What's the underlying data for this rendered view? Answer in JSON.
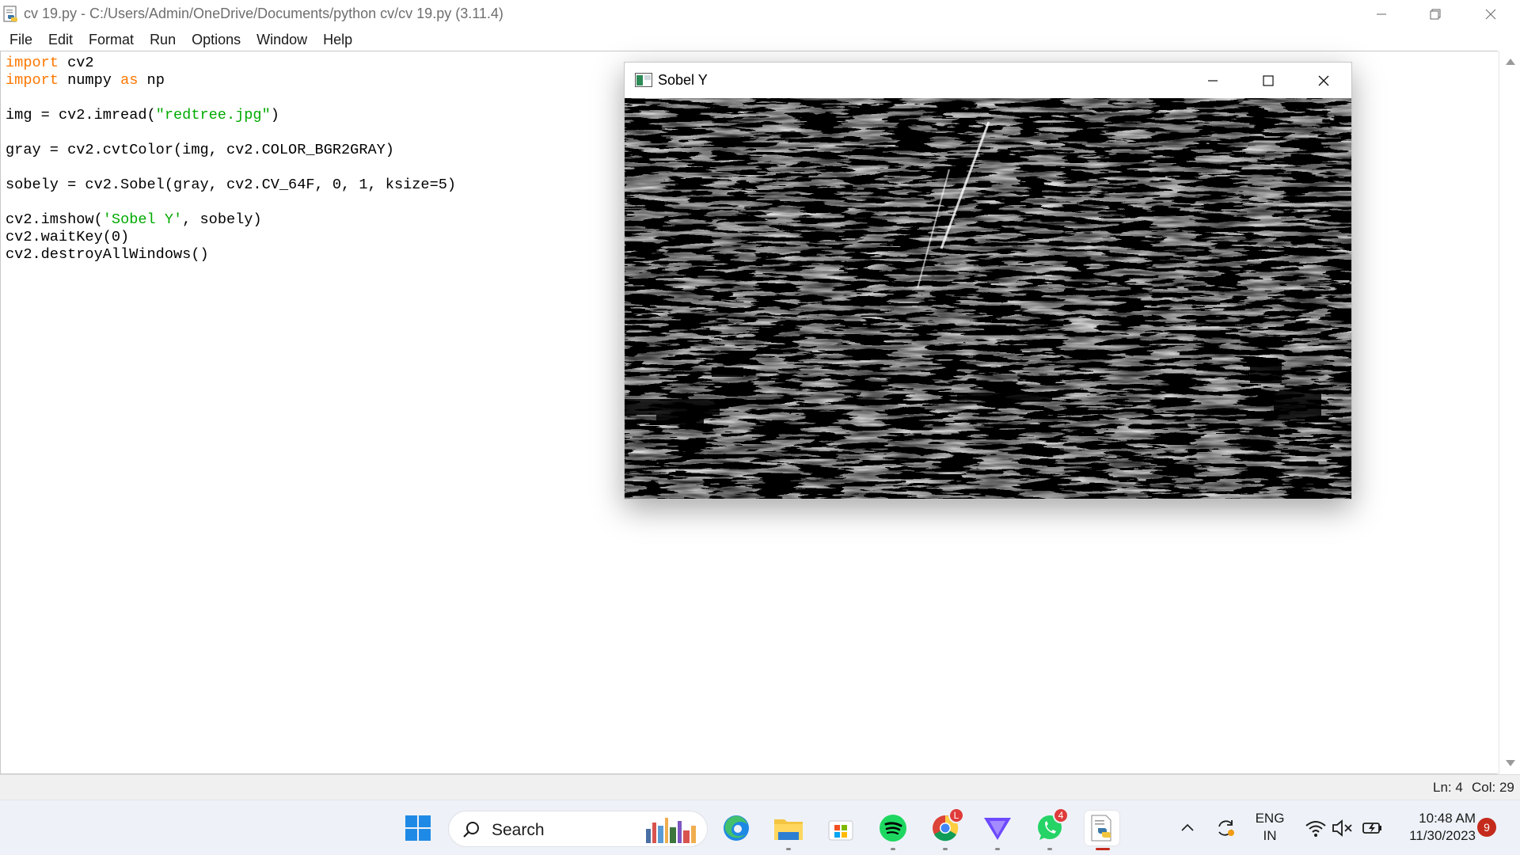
{
  "window": {
    "title": "cv 19.py - C:/Users/Admin/OneDrive/Documents/python cv/cv 19.py (3.11.4)",
    "controls": [
      "minimize-icon",
      "restore-icon",
      "close-icon"
    ]
  },
  "menu": {
    "items": [
      {
        "label": "File"
      },
      {
        "label": "Edit"
      },
      {
        "label": "Format"
      },
      {
        "label": "Run"
      },
      {
        "label": "Options"
      },
      {
        "label": "Window"
      },
      {
        "label": "Help"
      }
    ]
  },
  "editor": {
    "lines": [
      [
        {
          "t": "import",
          "c": "kw"
        },
        {
          "t": " cv2",
          "c": ""
        }
      ],
      [
        {
          "t": "import",
          "c": "kw"
        },
        {
          "t": " numpy ",
          "c": ""
        },
        {
          "t": "as",
          "c": "kw"
        },
        {
          "t": " np",
          "c": ""
        }
      ],
      [],
      [
        {
          "t": "img = cv2.imread(",
          "c": ""
        },
        {
          "t": "\"redtree.jpg\"",
          "c": "str"
        },
        {
          "t": ")",
          "c": ""
        }
      ],
      [],
      [
        {
          "t": "gray = cv2.cvtColor(img, cv2.COLOR_BGR2GRAY)",
          "c": ""
        }
      ],
      [],
      [
        {
          "t": "sobely = cv2.Sobel(gray, cv2.CV_64F, 0, 1, ksize=5)",
          "c": ""
        }
      ],
      [],
      [
        {
          "t": "cv2.imshow(",
          "c": ""
        },
        {
          "t": "'Sobel Y'",
          "c": "str"
        },
        {
          "t": ", sobely)",
          "c": ""
        }
      ],
      [
        {
          "t": "cv2.waitKey(0)",
          "c": ""
        }
      ],
      [
        {
          "t": "cv2.destroyAllWindows()",
          "c": ""
        }
      ]
    ],
    "syntax_colors": {
      "keyword": "#ff7700",
      "string": "#00aa00",
      "default": "#000000"
    }
  },
  "status": {
    "line": "Ln: 4",
    "col": "Col: 29"
  },
  "cv_window": {
    "title": "Sobel Y",
    "image_description": "black-and-white Sobel Y edge map",
    "controls": [
      "minimize-icon",
      "maximize-icon",
      "close-icon"
    ]
  },
  "taskbar": {
    "search_label": "Search",
    "apps": [
      {
        "name": "start-icon",
        "active": false
      },
      {
        "name": "edge-icon",
        "active": false
      },
      {
        "name": "file-explorer-icon",
        "active": false,
        "running": true
      },
      {
        "name": "microsoft-store-icon",
        "active": false
      },
      {
        "name": "spotify-icon",
        "active": false,
        "running": true
      },
      {
        "name": "chrome-icon",
        "active": false,
        "running": true,
        "badge": "L"
      },
      {
        "name": "proton-vpn-icon",
        "active": false,
        "running": true
      },
      {
        "name": "whatsapp-icon",
        "active": false,
        "running": true,
        "badge": "4"
      },
      {
        "name": "idle-python-icon",
        "active": true,
        "running": true
      }
    ],
    "tray": {
      "language": "ENG",
      "region": "IN",
      "time": "10:48 AM",
      "date": "11/30/2023",
      "notification_count": "9",
      "icons": [
        "chevron-up-icon",
        "sync-icon",
        "wifi-icon",
        "volume-muted-icon",
        "battery-icon"
      ]
    }
  }
}
